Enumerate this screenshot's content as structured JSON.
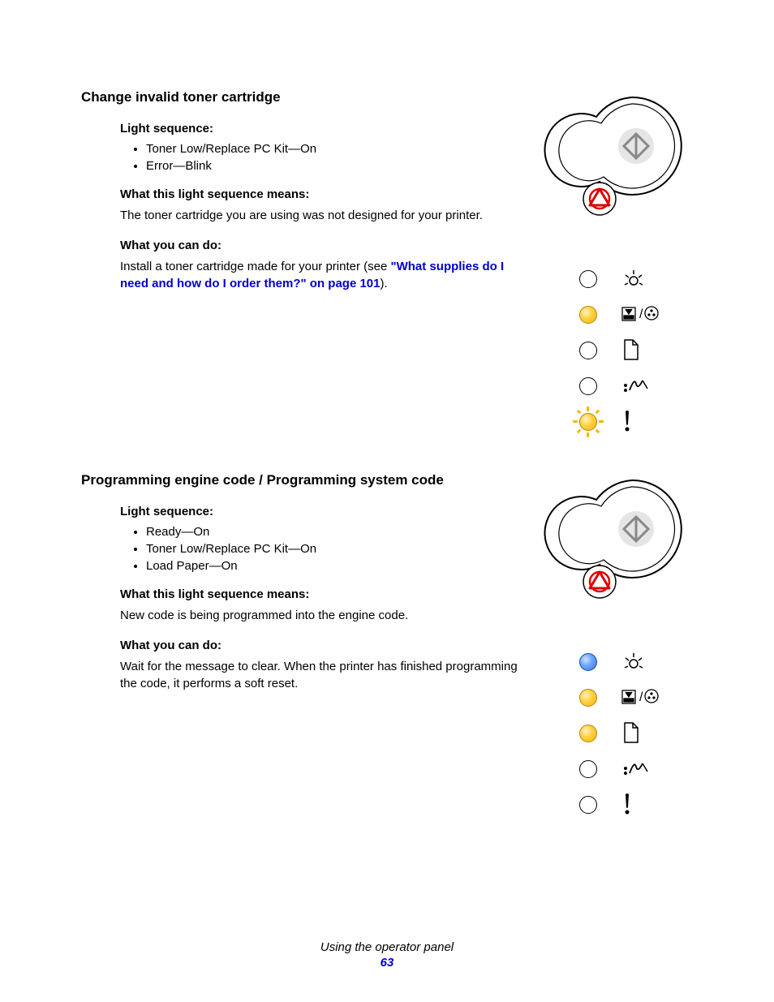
{
  "section1": {
    "title": "Change invalid toner cartridge",
    "light_heading": "Light sequence:",
    "light_items": [
      "Toner Low/Replace PC Kit—On",
      "Error—Blink"
    ],
    "means_heading": "What this light sequence means:",
    "means_body": "The toner cartridge you are using was not designed for your printer.",
    "do_heading": "What you can do:",
    "do_prefix": "Install a toner cartridge made for your printer (see ",
    "do_link": "\"What supplies do I need and how do I order them?\" on page 101",
    "do_suffix": ").",
    "panel": {
      "rows": [
        {
          "led": "empty",
          "icon": "ready"
        },
        {
          "led": "amber",
          "icon": "toner"
        },
        {
          "led": "empty",
          "icon": "paper"
        },
        {
          "led": "empty",
          "icon": "jam"
        },
        {
          "led": "blink-amber",
          "icon": "error"
        }
      ]
    }
  },
  "section2": {
    "title": "Programming engine code / Programming system code",
    "light_heading": "Light sequence:",
    "light_items": [
      "Ready—On",
      "Toner Low/Replace PC Kit—On",
      "Load Paper—On"
    ],
    "means_heading": "What this light sequence means:",
    "means_body": "New code is being programmed into the engine code.",
    "do_heading": "What you can do:",
    "do_body": "Wait for the message to clear. When the printer has finished programming the code, it performs a soft reset.",
    "panel": {
      "rows": [
        {
          "led": "blue",
          "icon": "ready"
        },
        {
          "led": "amber",
          "icon": "toner"
        },
        {
          "led": "amber",
          "icon": "paper"
        },
        {
          "led": "empty",
          "icon": "jam"
        },
        {
          "led": "empty",
          "icon": "error"
        }
      ]
    }
  },
  "footer": {
    "chapter": "Using the operator panel",
    "page": "63"
  }
}
